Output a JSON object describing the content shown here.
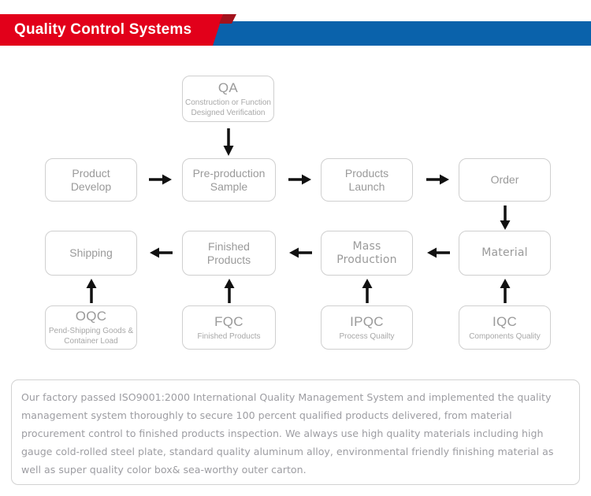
{
  "header": {
    "title": "Quality Control Systems",
    "red": "#e2001a",
    "blue": "#0a62ab",
    "notch": "#a3121c"
  },
  "flow": {
    "qa": {
      "title": "QA",
      "subtitle": "Construction or Function\nDesigned Verification"
    },
    "row1": [
      {
        "title": "Product\nDevelop"
      },
      {
        "title": "Pre-production\nSample"
      },
      {
        "title": "Products\nLaunch"
      },
      {
        "title": "Order"
      }
    ],
    "row2": [
      {
        "title": "Shipping"
      },
      {
        "title": "Finished\nProducts"
      },
      {
        "title": "Mass\nProduction"
      },
      {
        "title": "Material"
      }
    ],
    "row3": [
      {
        "title": "OQC",
        "subtitle": "Pend-Shipping Goods &\nContainer Load"
      },
      {
        "title": "FQC",
        "subtitle": "Finished Products"
      },
      {
        "title": "IPQC",
        "subtitle": "Process Quailty"
      },
      {
        "title": "IQC",
        "subtitle": "Components Quality"
      }
    ],
    "arrows": {
      "qa_to_sample": "arrow-down",
      "develop_to_sample": "arrow-right",
      "sample_to_launch": "arrow-right",
      "launch_to_order": "arrow-right",
      "order_to_material": "arrow-down",
      "material_to_mass": "arrow-left",
      "mass_to_finished": "arrow-left",
      "finished_to_shipping": "arrow-left",
      "iqc_to_material": "arrow-up",
      "ipqc_to_mass": "arrow-up",
      "fqc_to_finished": "arrow-up",
      "oqc_to_shipping": "arrow-up"
    }
  },
  "note": {
    "body": "Our factory passed ISO9001:2000 International Quality Management System and  implemented the quality management system thoroughly to secure 100 percent qualified products delivered, from material procurement control to finished products inspection. We always use high quality materials including high gauge cold-rolled steel plate, standard quality aluminum alloy, environmental friendly finishing material as well as super quality color box& sea-worthy outer carton."
  }
}
